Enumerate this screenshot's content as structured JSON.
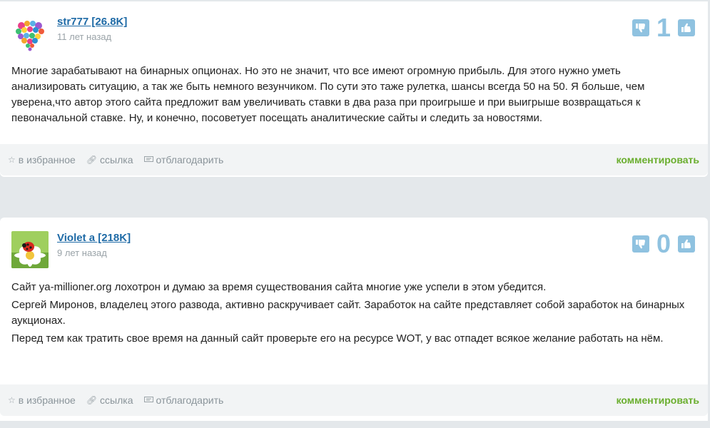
{
  "comments": [
    {
      "author": "str777 [26.8K]",
      "date": "11 лет назад",
      "score": "1",
      "paragraphs": [
        "Многие зарабатывают на бинарных опционах. Но это не значит, что все имеют огромную прибыль. Для этого нужно уметь анализировать ситуацию, а так же быть немного везунчиком. По сути это таже рулетка, шансы всегда 50 на 50. Я больше, чем уверена,что автор этого сайта предложит вам увеличивать ставки в два раза при проигрыше и при выигрыше возвращаться к певоначальной ставке. Ну, и конечно, посоветует посещать аналитические сайты и следить за новостями."
      ],
      "actions": {
        "favorite": "в избранное",
        "link": "ссылка",
        "thank": "отблагодарить",
        "comment": "комментировать"
      }
    },
    {
      "author": "Violet a [218K]",
      "date": "9 лет назад",
      "score": "0",
      "paragraphs": [
        "Сайт ya-millioner.org лохотрон и думаю за время существования сайта многие уже успели в этом убедится.",
        "Сергей Миронов, владелец этого развода, активно раскручивает сайт. Заработок на сайте представляет собой заработок на бинарных аукционах.",
        "Перед тем как тратить свое время на данный сайт проверьте его на ресурсе WOT, у вас отпадет всякое желание работать на нём."
      ],
      "actions": {
        "favorite": "в избранное",
        "link": "ссылка",
        "thank": "отблагодарить",
        "comment": "комментировать"
      }
    }
  ],
  "colors": {
    "author_link": "#1e6aa6",
    "vote_icon": "#8fc2e0",
    "comment_link": "#6aae2e",
    "page_bg": "#e4e8eb"
  },
  "icons": {
    "downvote": "thumbs-down-icon",
    "upvote": "thumbs-up-icon",
    "favorite": "star-icon",
    "link": "link-icon",
    "thank": "thank-icon"
  }
}
